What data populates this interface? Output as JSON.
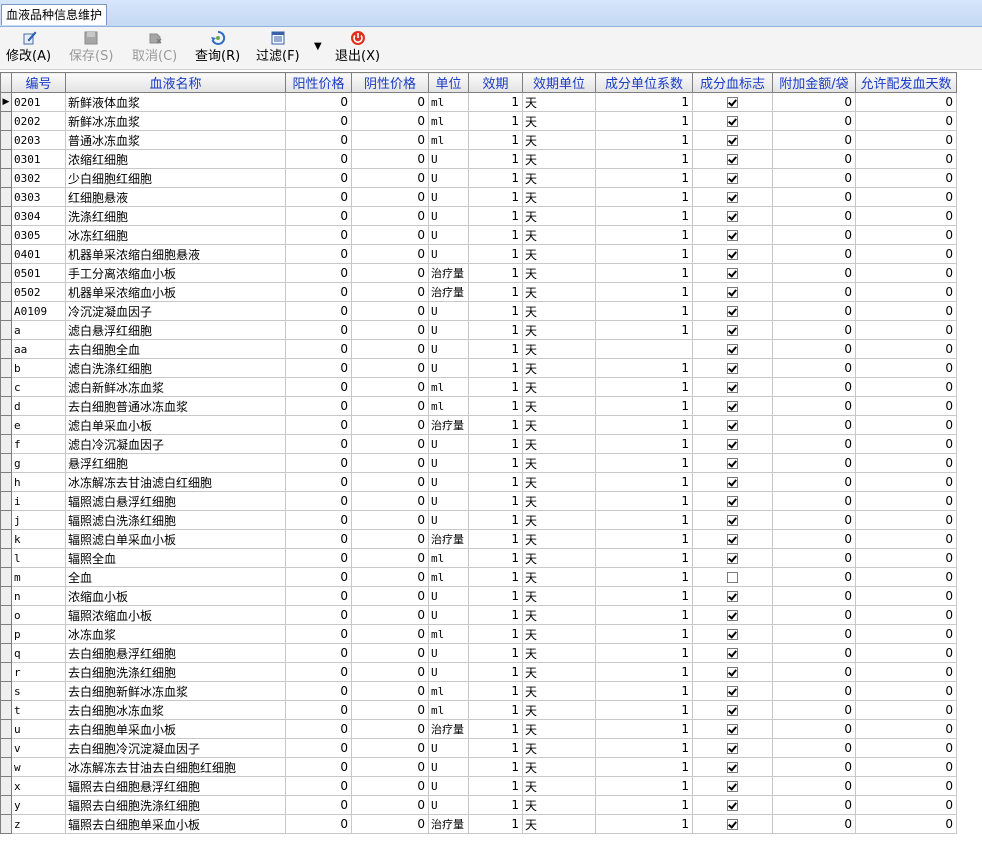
{
  "tab": {
    "title": "血液品种信息维护"
  },
  "toolbar": {
    "buttons": [
      {
        "label": "修改(A)",
        "icon": "edit-icon",
        "enabled": true
      },
      {
        "label": "保存(S)",
        "icon": "save-icon",
        "enabled": false
      },
      {
        "label": "取消(C)",
        "icon": "cancel-icon",
        "enabled": false
      },
      {
        "label": "查询(R)",
        "icon": "refresh-icon",
        "enabled": true
      },
      {
        "label": "过滤(F)",
        "icon": "filter-icon",
        "enabled": true
      },
      {
        "label": "退出(X)",
        "icon": "power-icon",
        "enabled": true
      }
    ],
    "dropdown": "▼"
  },
  "grid": {
    "columns": [
      "编号",
      "血液名称",
      "阳性价格",
      "阴性价格",
      "单位",
      "效期",
      "效期单位",
      "成分单位系数",
      "成分血标志",
      "附加金额/袋",
      "允许配发血天数"
    ],
    "current_marker": "▶",
    "rows": [
      {
        "code": "0201",
        "name": "新鲜液体血浆",
        "pos": "0",
        "neg": "0",
        "unit": "ml",
        "exp": "1",
        "exp_unit": "天",
        "coef": "1",
        "flag": true,
        "extra": "0",
        "days": "0"
      },
      {
        "code": "0202",
        "name": "新鲜冰冻血浆",
        "pos": "0",
        "neg": "0",
        "unit": "ml",
        "exp": "1",
        "exp_unit": "天",
        "coef": "1",
        "flag": true,
        "extra": "0",
        "days": "0"
      },
      {
        "code": "0203",
        "name": "普通冰冻血浆",
        "pos": "0",
        "neg": "0",
        "unit": "ml",
        "exp": "1",
        "exp_unit": "天",
        "coef": "1",
        "flag": true,
        "extra": "0",
        "days": "0"
      },
      {
        "code": "0301",
        "name": "浓缩红细胞",
        "pos": "0",
        "neg": "0",
        "unit": "U",
        "exp": "1",
        "exp_unit": "天",
        "coef": "1",
        "flag": true,
        "extra": "0",
        "days": "0"
      },
      {
        "code": "0302",
        "name": "少白细胞红细胞",
        "pos": "0",
        "neg": "0",
        "unit": "U",
        "exp": "1",
        "exp_unit": "天",
        "coef": "1",
        "flag": true,
        "extra": "0",
        "days": "0"
      },
      {
        "code": "0303",
        "name": "红细胞悬液",
        "pos": "0",
        "neg": "0",
        "unit": "U",
        "exp": "1",
        "exp_unit": "天",
        "coef": "1",
        "flag": true,
        "extra": "0",
        "days": "0"
      },
      {
        "code": "0304",
        "name": "洗涤红细胞",
        "pos": "0",
        "neg": "0",
        "unit": "U",
        "exp": "1",
        "exp_unit": "天",
        "coef": "1",
        "flag": true,
        "extra": "0",
        "days": "0"
      },
      {
        "code": "0305",
        "name": "冰冻红细胞",
        "pos": "0",
        "neg": "0",
        "unit": "U",
        "exp": "1",
        "exp_unit": "天",
        "coef": "1",
        "flag": true,
        "extra": "0",
        "days": "0"
      },
      {
        "code": "0401",
        "name": "机器单采浓缩白细胞悬液",
        "pos": "0",
        "neg": "0",
        "unit": "U",
        "exp": "1",
        "exp_unit": "天",
        "coef": "1",
        "flag": true,
        "extra": "0",
        "days": "0"
      },
      {
        "code": "0501",
        "name": "手工分离浓缩血小板",
        "pos": "0",
        "neg": "0",
        "unit": "治疗量",
        "exp": "1",
        "exp_unit": "天",
        "coef": "1",
        "flag": true,
        "extra": "0",
        "days": "0"
      },
      {
        "code": "0502",
        "name": "机器单采浓缩血小板",
        "pos": "0",
        "neg": "0",
        "unit": "治疗量",
        "exp": "1",
        "exp_unit": "天",
        "coef": "1",
        "flag": true,
        "extra": "0",
        "days": "0"
      },
      {
        "code": "A0109",
        "name": "冷沉淀凝血因子",
        "pos": "0",
        "neg": "0",
        "unit": "U",
        "exp": "1",
        "exp_unit": "天",
        "coef": "1",
        "flag": true,
        "extra": "0",
        "days": "0"
      },
      {
        "code": "a",
        "name": "滤白悬浮红细胞",
        "pos": "0",
        "neg": "0",
        "unit": "U",
        "exp": "1",
        "exp_unit": "天",
        "coef": "1",
        "flag": true,
        "extra": "0",
        "days": "0"
      },
      {
        "code": "aa",
        "name": "去白细胞全血",
        "pos": "0",
        "neg": "0",
        "unit": "U",
        "exp": "1",
        "exp_unit": "天",
        "coef": "",
        "flag": true,
        "extra": "0",
        "days": "0"
      },
      {
        "code": "b",
        "name": "滤白洗涤红细胞",
        "pos": "0",
        "neg": "0",
        "unit": "U",
        "exp": "1",
        "exp_unit": "天",
        "coef": "1",
        "flag": true,
        "extra": "0",
        "days": "0"
      },
      {
        "code": "c",
        "name": "滤白新鲜冰冻血浆",
        "pos": "0",
        "neg": "0",
        "unit": "ml",
        "exp": "1",
        "exp_unit": "天",
        "coef": "1",
        "flag": true,
        "extra": "0",
        "days": "0"
      },
      {
        "code": "d",
        "name": "去白细胞普通冰冻血浆",
        "pos": "0",
        "neg": "0",
        "unit": "ml",
        "exp": "1",
        "exp_unit": "天",
        "coef": "1",
        "flag": true,
        "extra": "0",
        "days": "0"
      },
      {
        "code": "e",
        "name": "滤白单采血小板",
        "pos": "0",
        "neg": "0",
        "unit": "治疗量",
        "exp": "1",
        "exp_unit": "天",
        "coef": "1",
        "flag": true,
        "extra": "0",
        "days": "0"
      },
      {
        "code": "f",
        "name": "滤白冷沉凝血因子",
        "pos": "0",
        "neg": "0",
        "unit": "U",
        "exp": "1",
        "exp_unit": "天",
        "coef": "1",
        "flag": true,
        "extra": "0",
        "days": "0"
      },
      {
        "code": "g",
        "name": "悬浮红细胞",
        "pos": "0",
        "neg": "0",
        "unit": "U",
        "exp": "1",
        "exp_unit": "天",
        "coef": "1",
        "flag": true,
        "extra": "0",
        "days": "0"
      },
      {
        "code": "h",
        "name": "冰冻解冻去甘油滤白红细胞",
        "pos": "0",
        "neg": "0",
        "unit": "U",
        "exp": "1",
        "exp_unit": "天",
        "coef": "1",
        "flag": true,
        "extra": "0",
        "days": "0"
      },
      {
        "code": "i",
        "name": "辐照滤白悬浮红细胞",
        "pos": "0",
        "neg": "0",
        "unit": "U",
        "exp": "1",
        "exp_unit": "天",
        "coef": "1",
        "flag": true,
        "extra": "0",
        "days": "0"
      },
      {
        "code": "j",
        "name": "辐照滤白洗涤红细胞",
        "pos": "0",
        "neg": "0",
        "unit": "U",
        "exp": "1",
        "exp_unit": "天",
        "coef": "1",
        "flag": true,
        "extra": "0",
        "days": "0"
      },
      {
        "code": "k",
        "name": "辐照滤白单采血小板",
        "pos": "0",
        "neg": "0",
        "unit": "治疗量",
        "exp": "1",
        "exp_unit": "天",
        "coef": "1",
        "flag": true,
        "extra": "0",
        "days": "0"
      },
      {
        "code": "l",
        "name": "辐照全血",
        "pos": "0",
        "neg": "0",
        "unit": "ml",
        "exp": "1",
        "exp_unit": "天",
        "coef": "1",
        "flag": true,
        "extra": "0",
        "days": "0"
      },
      {
        "code": "m",
        "name": "全血",
        "pos": "0",
        "neg": "0",
        "unit": "ml",
        "exp": "1",
        "exp_unit": "天",
        "coef": "1",
        "flag": false,
        "extra": "0",
        "days": "0"
      },
      {
        "code": "n",
        "name": "浓缩血小板",
        "pos": "0",
        "neg": "0",
        "unit": "U",
        "exp": "1",
        "exp_unit": "天",
        "coef": "1",
        "flag": true,
        "extra": "0",
        "days": "0"
      },
      {
        "code": "o",
        "name": "辐照浓缩血小板",
        "pos": "0",
        "neg": "0",
        "unit": "U",
        "exp": "1",
        "exp_unit": "天",
        "coef": "1",
        "flag": true,
        "extra": "0",
        "days": "0"
      },
      {
        "code": "p",
        "name": "冰冻血浆",
        "pos": "0",
        "neg": "0",
        "unit": "ml",
        "exp": "1",
        "exp_unit": "天",
        "coef": "1",
        "flag": true,
        "extra": "0",
        "days": "0"
      },
      {
        "code": "q",
        "name": "去白细胞悬浮红细胞",
        "pos": "0",
        "neg": "0",
        "unit": "U",
        "exp": "1",
        "exp_unit": "天",
        "coef": "1",
        "flag": true,
        "extra": "0",
        "days": "0"
      },
      {
        "code": "r",
        "name": "去白细胞洗涤红细胞",
        "pos": "0",
        "neg": "0",
        "unit": "U",
        "exp": "1",
        "exp_unit": "天",
        "coef": "1",
        "flag": true,
        "extra": "0",
        "days": "0"
      },
      {
        "code": "s",
        "name": "去白细胞新鲜冰冻血浆",
        "pos": "0",
        "neg": "0",
        "unit": "ml",
        "exp": "1",
        "exp_unit": "天",
        "coef": "1",
        "flag": true,
        "extra": "0",
        "days": "0"
      },
      {
        "code": "t",
        "name": "去白细胞冰冻血浆",
        "pos": "0",
        "neg": "0",
        "unit": "ml",
        "exp": "1",
        "exp_unit": "天",
        "coef": "1",
        "flag": true,
        "extra": "0",
        "days": "0"
      },
      {
        "code": "u",
        "name": "去白细胞单采血小板",
        "pos": "0",
        "neg": "0",
        "unit": "治疗量",
        "exp": "1",
        "exp_unit": "天",
        "coef": "1",
        "flag": true,
        "extra": "0",
        "days": "0"
      },
      {
        "code": "v",
        "name": "去白细胞冷沉淀凝血因子",
        "pos": "0",
        "neg": "0",
        "unit": "U",
        "exp": "1",
        "exp_unit": "天",
        "coef": "1",
        "flag": true,
        "extra": "0",
        "days": "0"
      },
      {
        "code": "w",
        "name": "冰冻解冻去甘油去白细胞红细胞",
        "pos": "0",
        "neg": "0",
        "unit": "U",
        "exp": "1",
        "exp_unit": "天",
        "coef": "1",
        "flag": true,
        "extra": "0",
        "days": "0"
      },
      {
        "code": "x",
        "name": "辐照去白细胞悬浮红细胞",
        "pos": "0",
        "neg": "0",
        "unit": "U",
        "exp": "1",
        "exp_unit": "天",
        "coef": "1",
        "flag": true,
        "extra": "0",
        "days": "0"
      },
      {
        "code": "y",
        "name": "辐照去白细胞洗涤红细胞",
        "pos": "0",
        "neg": "0",
        "unit": "U",
        "exp": "1",
        "exp_unit": "天",
        "coef": "1",
        "flag": true,
        "extra": "0",
        "days": "0"
      },
      {
        "code": "z",
        "name": "辐照去白细胞单采血小板",
        "pos": "0",
        "neg": "0",
        "unit": "治疗量",
        "exp": "1",
        "exp_unit": "天",
        "coef": "1",
        "flag": true,
        "extra": "0",
        "days": "0"
      }
    ]
  }
}
